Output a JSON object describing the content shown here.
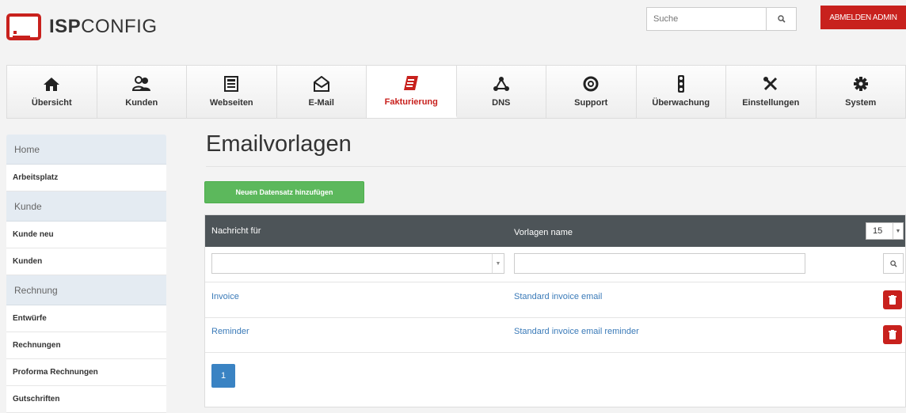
{
  "header": {
    "logo_bold": "ISP",
    "logo_light": "CONFIG",
    "search_placeholder": "Suche",
    "logout_label": "ABMELDEN ADMIN",
    "accent_color": "#c8211d"
  },
  "topnav": {
    "items": [
      {
        "label": "Übersicht",
        "icon": "home-icon"
      },
      {
        "label": "Kunden",
        "icon": "users-icon"
      },
      {
        "label": "Webseiten",
        "icon": "webpage-icon"
      },
      {
        "label": "E-Mail",
        "icon": "envelope-icon"
      },
      {
        "label": "Fakturierung",
        "icon": "billing-icon",
        "active": true
      },
      {
        "label": "DNS",
        "icon": "network-icon"
      },
      {
        "label": "Support",
        "icon": "lifebuoy-icon"
      },
      {
        "label": "Überwachung",
        "icon": "traffic-light-icon"
      },
      {
        "label": "Einstellungen",
        "icon": "tools-icon"
      },
      {
        "label": "System",
        "icon": "gear-icon"
      }
    ]
  },
  "sidebar": {
    "sections": [
      {
        "heading": "Home",
        "items": [
          "Arbeitsplatz"
        ]
      },
      {
        "heading": "Kunde",
        "items": [
          "Kunde neu",
          "Kunden"
        ]
      },
      {
        "heading": "Rechnung",
        "items": [
          "Entwürfe",
          "Rechnungen",
          "Proforma Rechnungen",
          "Gutschriften"
        ]
      }
    ]
  },
  "main": {
    "title": "Emailvorlagen",
    "add_button": "Neuen Datensatz hinzufügen",
    "table": {
      "columns": [
        "Nachricht für",
        "Vorlagen name"
      ],
      "per_page": "15",
      "rows": [
        {
          "message_for": "Invoice",
          "template_name": "Standard invoice email"
        },
        {
          "message_for": "Reminder",
          "template_name": "Standard invoice email reminder"
        }
      ]
    },
    "pagination": {
      "current_page": "1"
    }
  }
}
